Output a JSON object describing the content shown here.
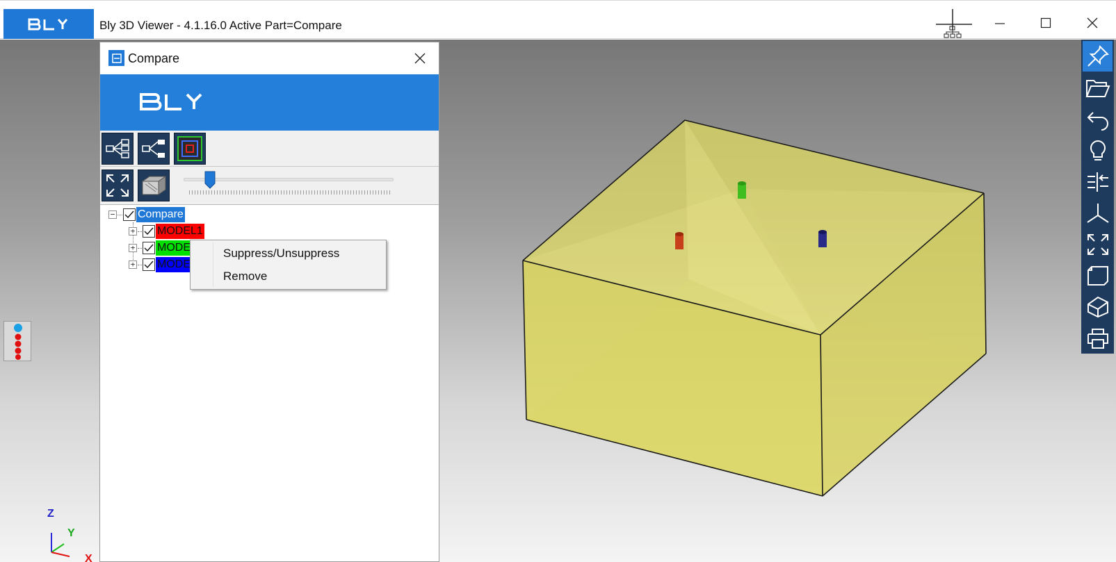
{
  "app": {
    "logo_text": "BLY",
    "window_title": "Bly 3D Viewer - 4.1.16.0 Active Part=Compare"
  },
  "window_controls": {
    "tree_icon": "network-tree-icon",
    "minimize_icon": "minimize-icon",
    "maximize_icon": "maximize-icon",
    "close_icon": "close-icon"
  },
  "compare_panel": {
    "title": "Compare",
    "banner_logo_text": "BLY",
    "toolbar_row1": [
      "tree-expand-icon",
      "tree-collapse-icon",
      "outline-square-icon"
    ],
    "toolbar_row2": [
      "fit-view-icon",
      "box-view-icon"
    ],
    "slider_value_fraction": 0.13,
    "tree": {
      "root": {
        "label": "Compare",
        "checked": true,
        "expanded": true
      },
      "children": [
        {
          "label": "MODEL1",
          "checked": true,
          "color": "#ff0000"
        },
        {
          "label": "MODEL2",
          "checked": true,
          "color": "#00e000"
        },
        {
          "label": "MODEL3",
          "checked": true,
          "color": "#0000ff"
        }
      ]
    }
  },
  "context_menu": {
    "items": [
      "Suppress/Unsuppress",
      "Remove"
    ]
  },
  "right_toolbar": {
    "icons": [
      "pin-icon",
      "open-folder-icon",
      "undo-icon",
      "lightbulb-icon",
      "compare-icon",
      "axes-icon",
      "fit-all-icon",
      "view-box-icon",
      "section-icon",
      "print-icon"
    ]
  },
  "axis_triad": {
    "z": "Z",
    "y": "Y",
    "x": "X"
  },
  "colors": {
    "brand": "#1f78d6",
    "toolbar_dark": "#1e3a5c",
    "part": "#e6e05a"
  }
}
